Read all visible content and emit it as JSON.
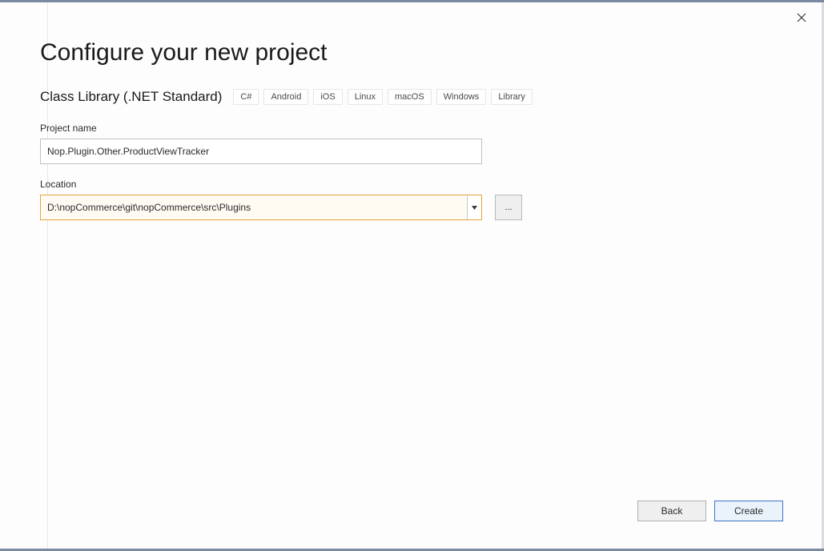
{
  "title": "Configure your new project",
  "template": {
    "name": "Class Library (.NET Standard)",
    "tags": [
      "C#",
      "Android",
      "iOS",
      "Linux",
      "macOS",
      "Windows",
      "Library"
    ]
  },
  "fields": {
    "projectName": {
      "label": "Project name",
      "value": "Nop.Plugin.Other.ProductViewTracker"
    },
    "location": {
      "label": "Location",
      "value": "D:\\nopCommerce\\git\\nopCommerce\\src\\Plugins"
    }
  },
  "buttons": {
    "browse": "...",
    "back": "Back",
    "create": "Create"
  }
}
